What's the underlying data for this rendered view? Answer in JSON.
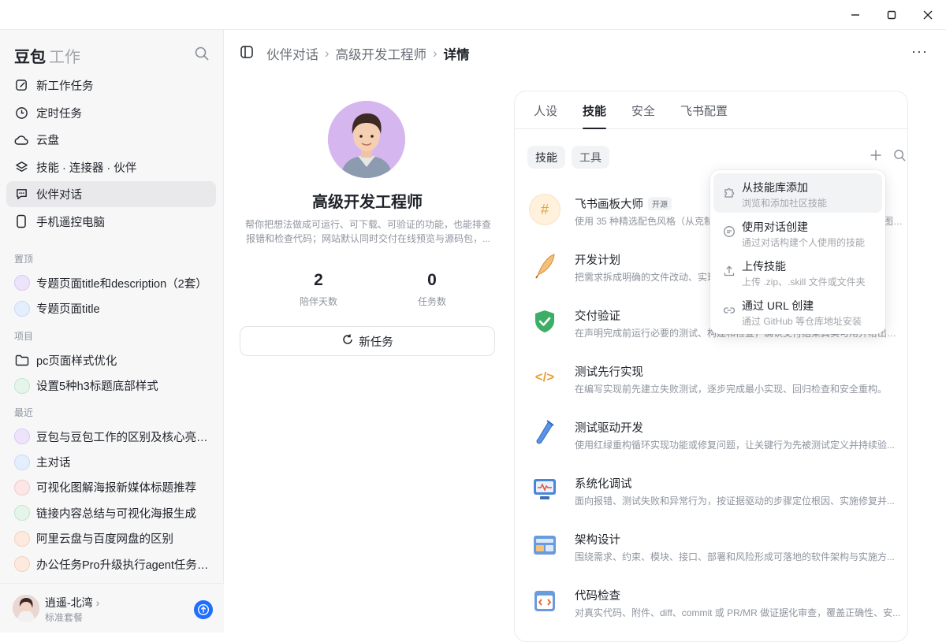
{
  "window": {
    "minimize": "—",
    "maximize": "☐",
    "close": "✕"
  },
  "sidebar": {
    "brand": "豆包",
    "brand_sub": "工作",
    "nav": [
      {
        "label": "新工作任务",
        "icon": "edit-icon"
      },
      {
        "label": "定时任务",
        "icon": "clock-icon"
      },
      {
        "label": "云盘",
        "icon": "cloud-icon"
      },
      {
        "label": "技能 · 连接器 · 伙伴",
        "icon": "layers-icon"
      },
      {
        "label": "伙伴对话",
        "icon": "chat-icon"
      },
      {
        "label": "手机遥控电脑",
        "icon": "phone-icon"
      }
    ],
    "pinned_label": "置顶",
    "pinned": [
      {
        "label": "专题页面title和description（2套）",
        "color": "#e8defa"
      },
      {
        "label": "专题页面title",
        "color": "#dce9fb"
      }
    ],
    "projects_label": "项目",
    "projects": [
      {
        "label": "pc页面样式优化",
        "icon": "folder-icon"
      },
      {
        "label": "设置5种h3标题底部样式",
        "color": "#dff2e3"
      }
    ],
    "recent_label": "最近",
    "recent": [
      {
        "label": "豆包与豆包工作的区别及核心亮点对比",
        "color": "#e8defa"
      },
      {
        "label": "主对话",
        "color": "#dce9fb"
      },
      {
        "label": "可视化图解海报新媒体标题推荐",
        "color": "#fbe0e0"
      },
      {
        "label": "链接内容总结与可视化海报生成",
        "color": "#dff2e3"
      },
      {
        "label": "阿里云盘与百度网盘的区别",
        "color": "#fbe4d8"
      },
      {
        "label": "办公任务Pro升级执行agent任务讲解",
        "color": "#fbe4d8"
      }
    ],
    "user": {
      "name": "逍遥-北湾",
      "plan": "标准套餐"
    }
  },
  "breadcrumb": {
    "items": [
      "伙伴对话",
      "高级开发工程师"
    ],
    "current": "详情"
  },
  "profile": {
    "name": "高级开发工程师",
    "desc": "帮你把想法做成可运行、可下载、可验证的功能，也能排查报错和检查代码；网站默认同时交付在线预览与源码包，...",
    "stats": [
      {
        "value": "2",
        "label": "陪伴天数"
      },
      {
        "value": "0",
        "label": "任务数"
      }
    ],
    "new_task": "新任务"
  },
  "tabs": [
    "人设",
    "技能",
    "安全",
    "飞书配置"
  ],
  "chips": [
    "技能",
    "工具"
  ],
  "skills": [
    {
      "name": "飞书画板大师",
      "badge": "开源",
      "desc": "使用 35 种精选配色风格（从克制高级到活泼鲜明）在飞书画板中创建专业图表（W...",
      "icon": "#",
      "bg": "#fff4e0",
      "fg": "#e39a2d"
    },
    {
      "name": "开发计划",
      "desc": "把需求拆成明确的文件改动、实现步骤与验证清单的开发计划",
      "icon": "✎",
      "bg": "#fff",
      "fg": "#d98a36"
    },
    {
      "name": "交付验证",
      "desc": "在声明完成前运行必要的测试、构建和检查，确认交付结果真实可用并给出证据结果。",
      "icon": "✔",
      "bg": "#fff",
      "fg": "#2e9e5b"
    },
    {
      "name": "测试先行实现",
      "desc": "在编写实现前先建立失败测试，逐步完成最小实现、回归检查和安全重构。",
      "icon": "</>",
      "bg": "#fff",
      "fg": "#e39a2d"
    },
    {
      "name": "测试驱动开发",
      "desc": "使用红绿重构循环实现功能或修复问题，让关键行为先被测试定义并持续验...",
      "icon": "⁄",
      "bg": "#fff",
      "fg": "#3d7bd9"
    },
    {
      "name": "系统化调试",
      "desc": "面向报错、测试失败和异常行为，按证据驱动的步骤定位根因、实施修复并...",
      "icon": "▣",
      "bg": "#fff",
      "fg": "#3d7bd9"
    },
    {
      "name": "架构设计",
      "desc": "围绕需求、约束、模块、接口、部署和风险形成可落地的软件架构与实施方...",
      "icon": "▤",
      "bg": "#fff",
      "fg": "#4a7fc7"
    },
    {
      "name": "代码检查",
      "desc": "对真实代码、附件、diff、commit 或 PR/MR 做证据化审查，覆盖正确性、安...",
      "icon": "◈",
      "bg": "#fff",
      "fg": "#e3612d"
    }
  ],
  "menu": [
    {
      "title": "从技能库添加",
      "desc": "浏览和添加社区技能",
      "icon": "puzzle-icon"
    },
    {
      "title": "使用对话创建",
      "desc": "通过对话构建个人使用的技能",
      "icon": "chat-bubble-icon"
    },
    {
      "title": "上传技能",
      "desc": "上传 .zip、.skill 文件或文件夹",
      "icon": "upload-icon"
    },
    {
      "title": "通过 URL 创建",
      "desc": "通过 GitHub 等仓库地址安装",
      "icon": "link-icon"
    }
  ]
}
